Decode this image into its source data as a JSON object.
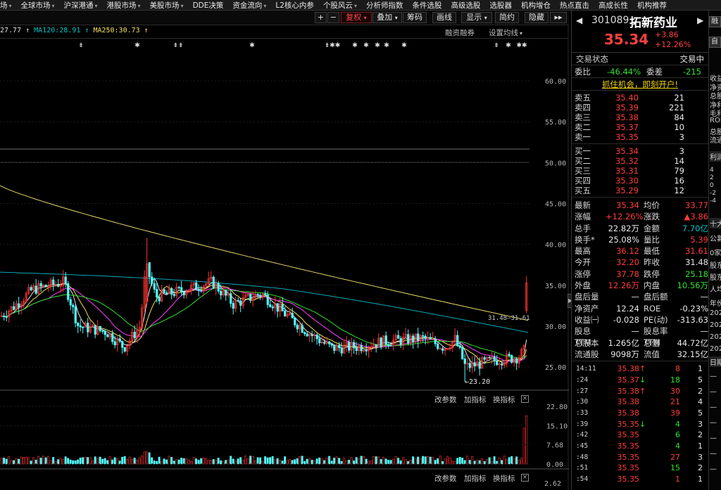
{
  "topnav": {
    "items": [
      {
        "label": "场",
        "caret": "▾"
      },
      {
        "label": "全球市场",
        "caret": "▾"
      },
      {
        "label": "沪深港通",
        "caret": "▾"
      },
      {
        "label": "港股市场",
        "caret": "▾"
      },
      {
        "label": "美股市场",
        "caret": "▾"
      },
      {
        "label": "DDE决策",
        "caret": ""
      },
      {
        "label": "资金流向",
        "caret": "▾"
      },
      {
        "label": "L2核心内参",
        "caret": ""
      },
      {
        "label": "个股风云",
        "caret": "▾"
      },
      {
        "label": "分析师指数",
        "caret": ""
      },
      {
        "label": "条件选股",
        "caret": ""
      },
      {
        "label": "高级选股",
        "caret": ""
      },
      {
        "label": "选股器",
        "caret": ""
      },
      {
        "label": "机构增仓",
        "caret": ""
      },
      {
        "label": "热点直击",
        "caret": ""
      },
      {
        "label": "高成长性",
        "caret": ""
      },
      {
        "label": "机构推荐",
        "caret": ""
      }
    ]
  },
  "toolbar": {
    "plus": "+",
    "minus": "−",
    "fuquan": "复权",
    "diejia": "叠加",
    "chouma": "筹码",
    "huaxian": "画线",
    "xianshi": "显示",
    "jianyue": "简约",
    "yincang": "隐藏",
    "more": "▸▸"
  },
  "ma_legend": [
    {
      "text": "27.77 ↑",
      "color": "#e0e0e0"
    },
    {
      "text": "MA120:28.91 ↑",
      "color": "#00c8c8"
    },
    {
      "text": "MA250:30.73 ↑",
      "color": "#f2e05a"
    }
  ],
  "main_links": {
    "rongzi": "融资融券",
    "shezhi": "设置均线",
    "caret": "▾"
  },
  "sub_links": {
    "gai": "改参数",
    "jia": "加指标",
    "huan": "换指标",
    "close": "×"
  },
  "price_axis": [
    "60.00",
    "55.00",
    "50.00",
    "45.00",
    "40.00",
    "35.00",
    "30.00",
    "25.00"
  ],
  "vol_axis": [
    "22.80",
    "15.10",
    "7.68",
    "0.00"
  ],
  "macd_axis": "2.62",
  "annotations": {
    "low": "←23.20",
    "ma_label": "31.48—31.61"
  },
  "markers": [
    "⇟",
    "✱",
    "⇟⇟",
    "✱",
    "⇟✱✱",
    "✱",
    "✱",
    "✱",
    "✱",
    "✱",
    "⇟",
    "✱",
    "✱✱"
  ],
  "chart_data": {
    "type": "candlestick",
    "y_range": [
      21,
      63
    ],
    "ma120_last": 28.91,
    "ma250_last": 30.73,
    "low_mark": 23.2,
    "last_close": 35.34
  },
  "stock": {
    "code": "301089",
    "name": "拓新药业",
    "price": "35.34",
    "change": "+3.86",
    "change_pct": "+12.26%",
    "left_arrow": "◀",
    "right_arrow": "▶"
  },
  "status": {
    "label": "交易状态",
    "value": "交易中"
  },
  "weibi": {
    "k1": "委比",
    "v1": "-46.44%",
    "k2": "委差",
    "v2": "-215"
  },
  "promo": "抓住机会，即刻开户!",
  "sells": [
    {
      "label": "卖五",
      "price": "35.40",
      "vol": "21"
    },
    {
      "label": "卖四",
      "price": "35.39",
      "vol": "221"
    },
    {
      "label": "卖三",
      "price": "35.38",
      "vol": "84"
    },
    {
      "label": "卖二",
      "price": "35.37",
      "vol": "10"
    },
    {
      "label": "卖一",
      "price": "35.35",
      "vol": "3"
    }
  ],
  "buys": [
    {
      "label": "买一",
      "price": "35.34",
      "vol": "3"
    },
    {
      "label": "买二",
      "price": "35.32",
      "vol": "14"
    },
    {
      "label": "买三",
      "price": "35.31",
      "vol": "79"
    },
    {
      "label": "买四",
      "price": "35.30",
      "vol": "16"
    },
    {
      "label": "买五",
      "price": "35.29",
      "vol": "12"
    }
  ],
  "stats": [
    {
      "k1": "最新",
      "v1": "35.34",
      "c1": "red",
      "k2": "均价",
      "v2": "33.77",
      "c2": "red"
    },
    {
      "k1": "涨幅",
      "v1": "+12.26%",
      "c1": "red",
      "k2": "涨跌",
      "v2": "▲3.86",
      "c2": "red"
    },
    {
      "k1": "总手",
      "v1": "22.82万",
      "c1": "white",
      "k2": "金额",
      "v2": "7.70亿",
      "c2": "cyan"
    },
    {
      "k1": "换手*",
      "v1": "25.08%",
      "c1": "white",
      "k2": "量比",
      "v2": "5.39",
      "c2": "red"
    },
    {
      "k1": "最高",
      "v1": "36.12",
      "c1": "red",
      "k2": "最低",
      "v2": "31.61",
      "c2": "red"
    },
    {
      "k1": "今开",
      "v1": "32.20",
      "c1": "red",
      "k2": "昨收",
      "v2": "31.48",
      "c2": "white"
    },
    {
      "k1": "涨停",
      "v1": "37.78",
      "c1": "red",
      "k2": "跌停",
      "v2": "25.18",
      "c2": "green"
    },
    {
      "k1": "外盘",
      "v1": "12.26万",
      "c1": "red",
      "k2": "内盘",
      "v2": "10.56万",
      "c2": "green"
    },
    {
      "k1": "盘后量",
      "v1": "—",
      "c1": "white",
      "k2": "盘后额",
      "v2": "—",
      "c2": "white"
    },
    {
      "k1": "净资产",
      "v1": "12.24",
      "c1": "white",
      "k2": "ROE",
      "v2": "-0.23%",
      "c2": "white"
    },
    {
      "k1": "收益㈠",
      "v1": "-0.028",
      "c1": "white",
      "k2": "PE(动)",
      "v2": "-313.63",
      "c2": "white"
    },
    {
      "k1": "股息TTM",
      "v1": "—",
      "c1": "white",
      "k2": "股息率TTM",
      "v2": "—",
      "c2": "white"
    },
    {
      "k1": "总股本",
      "v1": "1.265亿",
      "c1": "white",
      "k2": "总值",
      "v2": "44.72亿",
      "c2": "white"
    },
    {
      "k1": "流通股",
      "v1": "9098万",
      "c1": "white",
      "k2": "流值",
      "v2": "32.15亿",
      "c2": "white"
    }
  ],
  "trades": [
    {
      "time": "14:11",
      "price": "35.38",
      "dir": "↑",
      "dc": "red",
      "vol": "8",
      "vc": "red",
      "n": "1"
    },
    {
      "time": ":24",
      "price": "35.37",
      "dir": "↓",
      "dc": "green",
      "vol": "18",
      "vc": "green",
      "n": "5"
    },
    {
      "time": ":27",
      "price": "35.38",
      "dir": "↑",
      "dc": "red",
      "vol": "30",
      "vc": "red",
      "n": "2"
    },
    {
      "time": ":30",
      "price": "35.38",
      "dir": "",
      "dc": "red",
      "vol": "21",
      "vc": "red",
      "n": "4"
    },
    {
      "time": ":33",
      "price": "35.38",
      "dir": "",
      "dc": "red",
      "vol": "39",
      "vc": "red",
      "n": "5"
    },
    {
      "time": ":39",
      "price": "35.35",
      "dir": "↓",
      "dc": "green",
      "vol": "4",
      "vc": "green",
      "n": "3"
    },
    {
      "time": ":42",
      "price": "35.35",
      "dir": "",
      "dc": "red",
      "vol": "6",
      "vc": "green",
      "n": "2"
    },
    {
      "time": ":45",
      "price": "35.35",
      "dir": "",
      "dc": "red",
      "vol": "4",
      "vc": "green",
      "n": "1"
    },
    {
      "time": ":48",
      "price": "35.35",
      "dir": "",
      "dc": "red",
      "vol": "27",
      "vc": "red",
      "n": "3"
    },
    {
      "time": ":51",
      "price": "35.35",
      "dir": "",
      "dc": "red",
      "vol": "15",
      "vc": "green",
      "n": "2"
    },
    {
      "time": ":54",
      "price": "35.35",
      "dir": "",
      "dc": "red",
      "vol": "1",
      "vc": "red",
      "n": "1"
    }
  ],
  "strip": {
    "btn1": "融",
    "btn2": "自",
    "labels": [
      "收益",
      "净资",
      "总股",
      "净利",
      "毛利",
      "ROE",
      "总股",
      "流通"
    ],
    "profit": "利润",
    "axis": [
      "4",
      "2",
      "0",
      "-2",
      "-4"
    ],
    "ten": "十大",
    "gong": "公募",
    "zero": "0家",
    "holders": [
      "股东",
      "股东",
      "人均"
    ],
    "year": "年份",
    "years": [
      "202",
      "202",
      "202",
      "202"
    ],
    "ri": "日期",
    "dashes": [
      "—",
      "—",
      "—",
      "—",
      "—",
      "—",
      "—"
    ]
  }
}
